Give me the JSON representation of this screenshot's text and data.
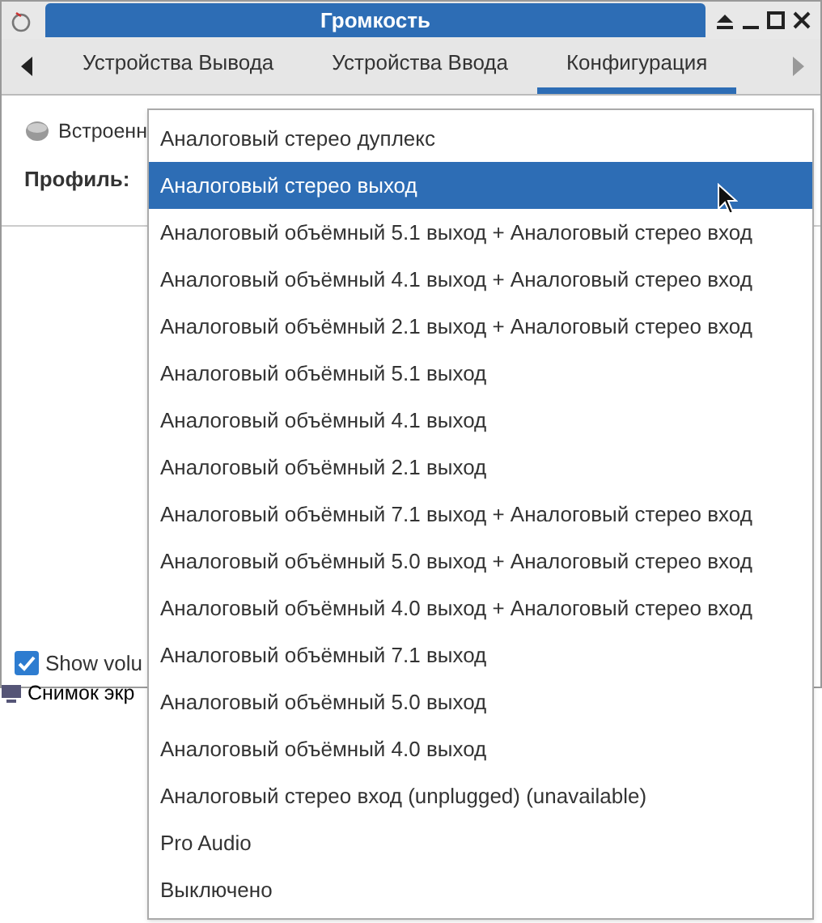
{
  "window": {
    "title": "Громкость"
  },
  "tabs": [
    {
      "label": "Устройства Вывода",
      "selected": false
    },
    {
      "label": "Устройства Ввода",
      "selected": false
    },
    {
      "label": "Конфигурация",
      "selected": true
    }
  ],
  "device": {
    "name": "Встроенн"
  },
  "profile": {
    "label": "Профиль:"
  },
  "show_volume": {
    "label": "Show volu",
    "checked": true
  },
  "desktop_item": {
    "label": "Снимок экр"
  },
  "menu": [
    {
      "label": "Аналоговый стерео дуплекс",
      "selected": false
    },
    {
      "label": "Аналоговый стерео выход",
      "selected": true
    },
    {
      "label": "Аналоговый объёмный 5.1 выход + Аналоговый стерео вход",
      "selected": false
    },
    {
      "label": "Аналоговый объёмный 4.1 выход + Аналоговый стерео вход",
      "selected": false
    },
    {
      "label": "Аналоговый объёмный 2.1 выход + Аналоговый стерео вход",
      "selected": false
    },
    {
      "label": "Аналоговый объёмный 5.1 выход",
      "selected": false
    },
    {
      "label": "Аналоговый объёмный 4.1 выход",
      "selected": false
    },
    {
      "label": "Аналоговый объёмный 2.1 выход",
      "selected": false
    },
    {
      "label": "Аналоговый объёмный 7.1 выход + Аналоговый стерео вход",
      "selected": false
    },
    {
      "label": "Аналоговый объёмный 5.0 выход + Аналоговый стерео вход",
      "selected": false
    },
    {
      "label": "Аналоговый объёмный 4.0 выход + Аналоговый стерео вход",
      "selected": false
    },
    {
      "label": "Аналоговый объёмный 7.1 выход",
      "selected": false
    },
    {
      "label": "Аналоговый объёмный 5.0 выход",
      "selected": false
    },
    {
      "label": "Аналоговый объёмный 4.0 выход",
      "selected": false
    },
    {
      "label": "Аналоговый стерео вход (unplugged) (unavailable)",
      "selected": false
    },
    {
      "label": "Pro Audio",
      "selected": false
    },
    {
      "label": "Выключено",
      "selected": false
    }
  ]
}
